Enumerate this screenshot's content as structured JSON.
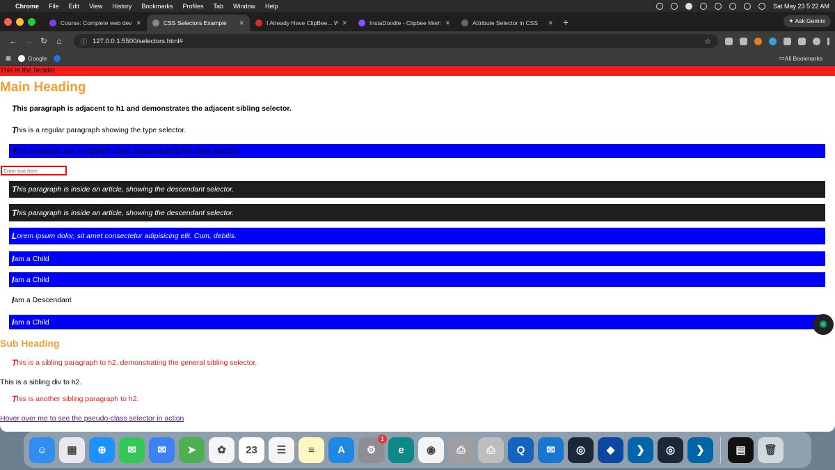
{
  "menubar": {
    "items": [
      "Chrome",
      "File",
      "Edit",
      "View",
      "History",
      "Bookmarks",
      "Profiles",
      "Tab",
      "Window",
      "Help"
    ],
    "datetime": "Sat May 23  5:22 AM"
  },
  "tabs": [
    {
      "title": "Course: Complete web develo",
      "color": "#7b3fe4",
      "active": false
    },
    {
      "title": "CSS Selectors Example",
      "color": "#888888",
      "active": true
    },
    {
      "title": "I Already Have ClipBee... Why",
      "color": "#d93025",
      "active": false
    },
    {
      "title": "InstaDoodle - Clipbee Membe",
      "color": "#8a4fff",
      "active": false
    },
    {
      "title": "Attribute Selector in CSS",
      "color": "#666666",
      "active": false
    }
  ],
  "gemini_label": "Ask Gemini",
  "address": "127.0.0.1:5500/selectors.html#",
  "bookmarks": {
    "google": "Google",
    "all": "All Bookmarks"
  },
  "page": {
    "header": "This is the header",
    "h1": "Main Heading",
    "adjacent": {
      "first": "T",
      "rest": "his paragraph is adjacent to h1 and demonstrates the adjacent sibling selector."
    },
    "type": {
      "first": "T",
      "rest": "his is a regular paragraph showing the type selector."
    },
    "highlight": {
      "first": "T",
      "rest": "his paragraph has a highlight class, demonstrating the class selector."
    },
    "input_placeholder": "Enter text here",
    "article1": {
      "first": "T",
      "rest": "his paragraph is inside an article, showing the descendant selector."
    },
    "article2": {
      "first": "T",
      "rest": "his paragraph is inside an article, showing the descendant selector."
    },
    "lorem": {
      "first": "L",
      "rest": "orem ipsum dolor, sit amet consectetur adipisicing elit. Cum, debitis."
    },
    "child1": {
      "first": "I",
      "rest": " am a Child"
    },
    "child2": {
      "first": "I",
      "rest": " am a Child"
    },
    "descendant": {
      "first": "I",
      "rest": " am a Descendant"
    },
    "child3": {
      "first": "I",
      "rest": " am a Child"
    },
    "h2": "Sub Heading",
    "sibling1": {
      "first": "T",
      "rest": "his is a sibling paragraph to h2, demonstrating the general sibling selector."
    },
    "sibling_div": "This is a sibling div to h2.",
    "sibling2": {
      "first": "T",
      "rest": "his is another sibling paragraph to h2."
    },
    "hover_link": "Hover over me to see the pseudo-class selector in action"
  },
  "dock": {
    "apps": [
      {
        "name": "finder",
        "color": "#2f8ef0",
        "glyph": "☺"
      },
      {
        "name": "launchpad",
        "color": "#e8e8ee",
        "glyph": "▦"
      },
      {
        "name": "safari",
        "color": "#1e90ff",
        "glyph": "⊕"
      },
      {
        "name": "messages",
        "color": "#34c759",
        "glyph": "✉"
      },
      {
        "name": "mail",
        "color": "#3b82f6",
        "glyph": "✉"
      },
      {
        "name": "maps",
        "color": "#4caf50",
        "glyph": "➤"
      },
      {
        "name": "photos",
        "color": "#f5f5f5",
        "glyph": "✿"
      },
      {
        "name": "calendar",
        "color": "#ffffff",
        "glyph": "23"
      },
      {
        "name": "reminders",
        "color": "#f5f5f5",
        "glyph": "☰"
      },
      {
        "name": "notes",
        "color": "#fff7c2",
        "glyph": "≡"
      },
      {
        "name": "app-store",
        "color": "#1e88e5",
        "glyph": "A"
      },
      {
        "name": "system-settings",
        "color": "#8e8e93",
        "glyph": "⚙",
        "badge": "1"
      },
      {
        "name": "edge",
        "color": "#0c8a8a",
        "glyph": "e"
      },
      {
        "name": "chrome",
        "color": "#f4f4f4",
        "glyph": "◉"
      },
      {
        "name": "printer",
        "color": "#9e9e9e",
        "glyph": "⎙"
      },
      {
        "name": "printer-queue",
        "color": "#bdbdbd",
        "glyph": "⎙"
      },
      {
        "name": "quicktime",
        "color": "#1565c0",
        "glyph": "Q"
      },
      {
        "name": "messenger",
        "color": "#1976d2",
        "glyph": "✉"
      },
      {
        "name": "steam",
        "color": "#1b2838",
        "glyph": "◎"
      },
      {
        "name": "vpn",
        "color": "#0d47a1",
        "glyph": "◆"
      },
      {
        "name": "vscode",
        "color": "#0065a9",
        "glyph": "❯"
      },
      {
        "name": "steam-2",
        "color": "#1b2838",
        "glyph": "◎"
      },
      {
        "name": "vscode-2",
        "color": "#0065a9",
        "glyph": "❯"
      },
      {
        "name": "recent-window",
        "color": "#111111",
        "glyph": "▤"
      },
      {
        "name": "trash",
        "color": "#cfd8dc",
        "glyph": "🗑"
      }
    ]
  }
}
